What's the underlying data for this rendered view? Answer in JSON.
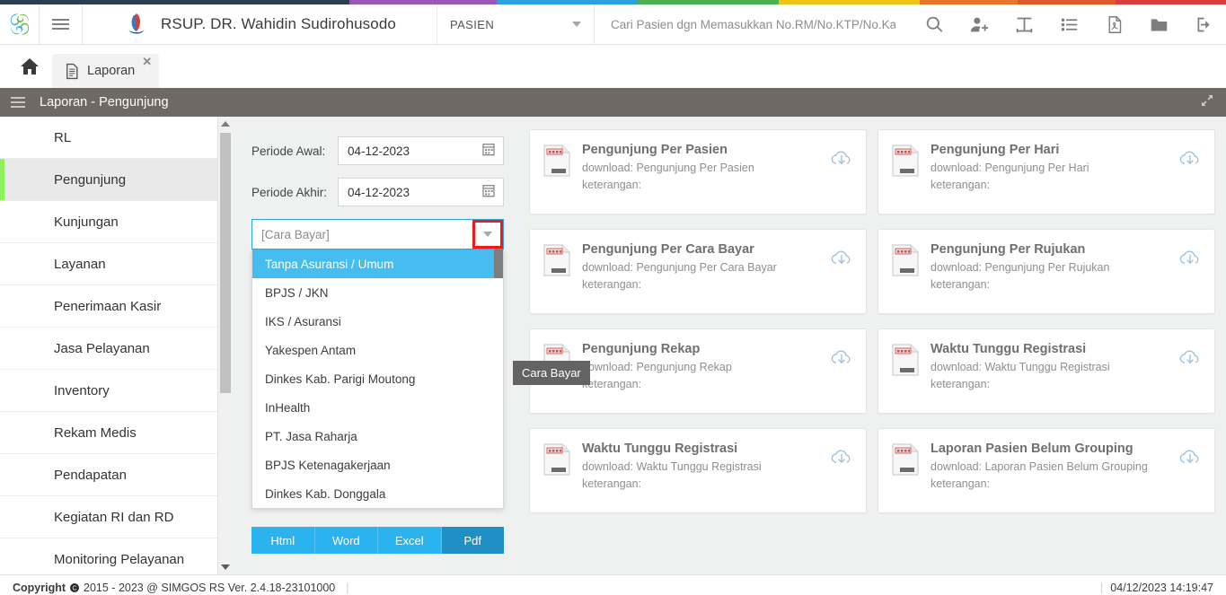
{
  "topstrip": {
    "colors": [
      "#2d3e50",
      "#9b59b6",
      "#2e9fe0",
      "#4caf50",
      "#f0c319",
      "#e8762a",
      "#e05a2b",
      "#d93d3d"
    ],
    "widths": [
      28.5,
      12,
      11.5,
      11.5,
      11.5,
      8,
      8,
      9
    ]
  },
  "topbar": {
    "logo_name": "simgos-logo",
    "menu_toggle": "menu-toggle",
    "hospital_name": "RSUP. DR. Wahidin Sudirohusodo",
    "context_select": "PASIEN",
    "search_placeholder": "Cari Pasien dgn Memasukkan No.RM/No.KTP/No.Kartu BPJS/",
    "search_value": "",
    "icons": [
      {
        "name": "search-icon",
        "title": "Cari"
      },
      {
        "name": "add-user-icon",
        "title": "Tambah Pasien"
      },
      {
        "name": "text-tool-icon",
        "title": "Teks"
      },
      {
        "name": "list-icon",
        "title": "Daftar"
      },
      {
        "name": "pdf-icon",
        "title": "PDF"
      },
      {
        "name": "folder-icon",
        "title": "Folder"
      },
      {
        "name": "logout-icon",
        "title": "Keluar"
      }
    ]
  },
  "tabs": {
    "home_label": "Beranda",
    "items": [
      {
        "label": "Laporan",
        "icon": "document-icon",
        "closable": true,
        "active": true
      }
    ]
  },
  "pageheader": {
    "title": "Laporan - Pengunjung",
    "menu_icon": "hamburger-icon",
    "expand_icon": "expand-icon"
  },
  "sidebar": {
    "items": [
      {
        "label": "RL",
        "active": false
      },
      {
        "label": "Pengunjung",
        "active": true
      },
      {
        "label": "Kunjungan",
        "active": false
      },
      {
        "label": "Layanan",
        "active": false
      },
      {
        "label": "Penerimaan Kasir",
        "active": false
      },
      {
        "label": "Jasa Pelayanan",
        "active": false
      },
      {
        "label": "Inventory",
        "active": false
      },
      {
        "label": "Rekam Medis",
        "active": false
      },
      {
        "label": "Pendapatan",
        "active": false
      },
      {
        "label": "Kegiatan RI dan RD",
        "active": false
      },
      {
        "label": "Monitoring Pelayanan",
        "active": false
      }
    ]
  },
  "form": {
    "periode_awal_label": "Periode Awal:",
    "periode_awal_value": "04-12-2023",
    "periode_akhir_label": "Periode Akhir:",
    "periode_akhir_value": "04-12-2023",
    "select_placeholder": "[Cara Bayar]",
    "select_value": "",
    "tooltip": "Cara Bayar",
    "dropdown_options": [
      {
        "label": "Tanpa Asuransi / Umum",
        "selected": true
      },
      {
        "label": "BPJS / JKN",
        "selected": false
      },
      {
        "label": "IKS / Asuransi",
        "selected": false
      },
      {
        "label": "Yakespen Antam",
        "selected": false
      },
      {
        "label": "Dinkes Kab. Parigi Moutong",
        "selected": false
      },
      {
        "label": "InHealth",
        "selected": false
      },
      {
        "label": "PT. Jasa Raharja",
        "selected": false
      },
      {
        "label": "BPJS Ketenagakerjaan",
        "selected": false
      },
      {
        "label": "Dinkes Kab. Donggala",
        "selected": false
      }
    ],
    "format_buttons": [
      {
        "label": "Html",
        "active": false
      },
      {
        "label": "Word",
        "active": false
      },
      {
        "label": "Excel",
        "active": false
      },
      {
        "label": "Pdf",
        "active": true
      }
    ]
  },
  "reports": {
    "download_prefix": "download: ",
    "keterangan_label": "keterangan:",
    "cards": [
      {
        "title": "Pengunjung Per Pasien",
        "download": "download: Pengunjung Per Pasien",
        "keterangan": "keterangan:"
      },
      {
        "title": "Pengunjung Per Hari",
        "download": "download: Pengunjung Per Hari",
        "keterangan": "keterangan:"
      },
      {
        "title": "Pengunjung Per Cara Bayar",
        "download": "download: Pengunjung Per Cara Bayar",
        "keterangan": "keterangan:"
      },
      {
        "title": "Pengunjung Per Rujukan",
        "download": "download: Pengunjung Per Rujukan",
        "keterangan": "keterangan:"
      },
      {
        "title": "Pengunjung Rekap",
        "download": "download: Pengunjung Rekap",
        "keterangan": "keterangan:"
      },
      {
        "title": "Waktu Tunggu Registrasi",
        "download": "download: Waktu Tunggu Registrasi",
        "keterangan": "keterangan:"
      },
      {
        "title": "Waktu Tunggu Registrasi",
        "download": "download: Waktu Tunggu Registrasi",
        "keterangan": "keterangan:"
      },
      {
        "title": "Laporan Pasien Belum Grouping",
        "download": "download: Laporan Pasien Belum Grouping",
        "keterangan": "keterangan:"
      }
    ],
    "file_badge": "LAPORAN"
  },
  "footer": {
    "copyright_word": "Copyright",
    "copyright_text": "2015 - 2023 @ SIMGOS RS Ver. 2.4.18-23101000",
    "datetime": "04/12/2023 14:19:47"
  },
  "colors": {
    "accent_blue": "#2ab3ef",
    "accent_blue_dark": "#2090c4",
    "highlight_red": "#ee1b1b",
    "active_green": "#8ef05b",
    "header_gray": "#6e6962"
  }
}
